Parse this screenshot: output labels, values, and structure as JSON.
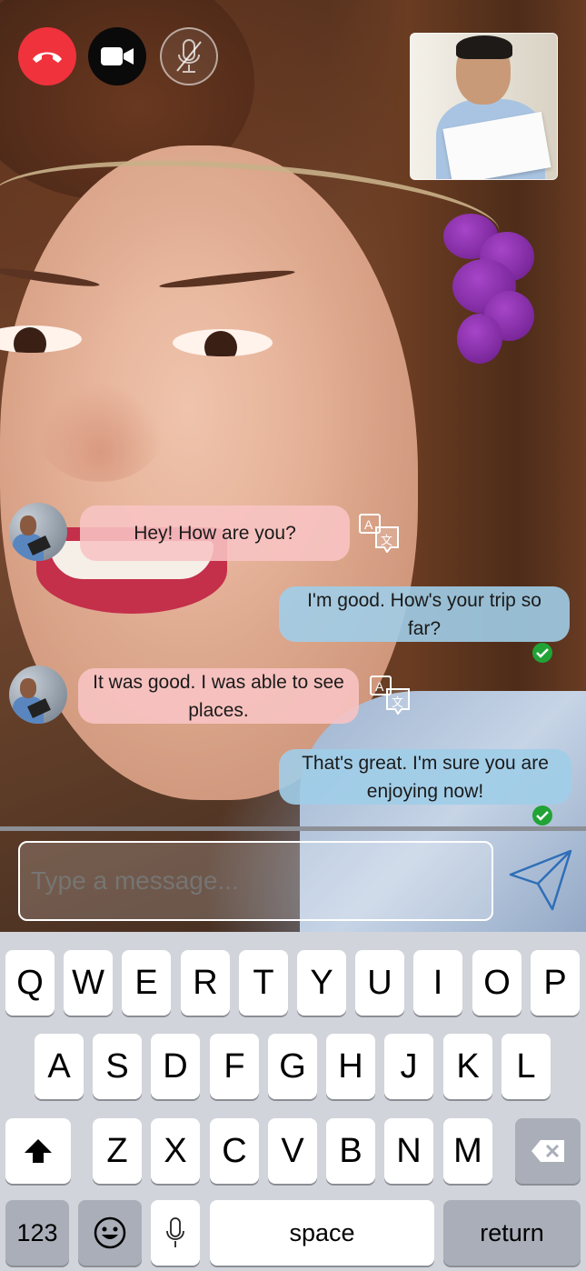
{
  "call_controls": {
    "end_call": "phone-hangup-icon",
    "camera": "video-camera-icon",
    "mic": "mic-off-icon",
    "end_call_color": "#f0323c"
  },
  "messages": [
    {
      "direction": "incoming",
      "text": "Hey! How are you?",
      "translatable": true
    },
    {
      "direction": "outgoing",
      "text": "I'm good. How's your trip so far?",
      "delivered": true
    },
    {
      "direction": "incoming",
      "text": "It was good. I was able to see places.",
      "translatable": true
    },
    {
      "direction": "outgoing",
      "text": "That's great. I'm sure you are enjoying now!",
      "delivered": true
    }
  ],
  "composer": {
    "placeholder": "Type a message...",
    "send_icon": "paper-plane-icon"
  },
  "keyboard": {
    "row1": [
      "Q",
      "W",
      "E",
      "R",
      "T",
      "Y",
      "U",
      "I",
      "O",
      "P"
    ],
    "row2": [
      "A",
      "S",
      "D",
      "F",
      "G",
      "H",
      "J",
      "K",
      "L"
    ],
    "row3": [
      "Z",
      "X",
      "C",
      "V",
      "B",
      "N",
      "M"
    ],
    "shift_icon": "shift-arrow-icon",
    "backspace_icon": "backspace-icon",
    "numbers_label": "123",
    "emoji_icon": "emoji-icon",
    "dictation_icon": "microphone-icon",
    "space_label": "space",
    "return_label": "return"
  }
}
